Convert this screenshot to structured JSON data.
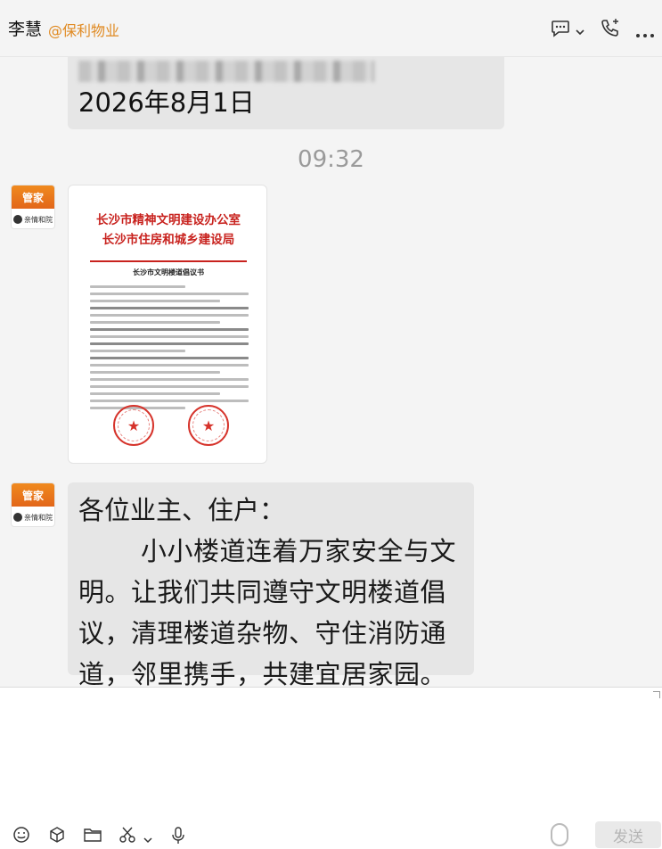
{
  "header": {
    "contact_name": "李慧",
    "contact_org": "@保利物业",
    "icons": [
      "chat-bubble-icon",
      "chevron-down-icon",
      "phone-icon",
      "more-icon"
    ]
  },
  "messages": {
    "top_bubble_date": "2026年8月1日",
    "timestamp": "09:32",
    "avatar": {
      "badge": "管家",
      "brand": "亲情和院"
    },
    "document_image": {
      "org_line_1": "长沙市精神文明建设办公室",
      "org_line_2": "长沙市住房和城乡建设局",
      "doc_title": "长沙市文明楼道倡议书"
    },
    "text_message": {
      "greeting": "各位业主、住户：",
      "body": "小小楼道连着万家安全与文明。让我们共同遵守文明楼道倡议，清理楼道杂物、守住消防通道，邻里携手，共建宜居家园。"
    }
  },
  "input": {
    "send_label": "发送",
    "toolbar_icons": [
      "emoji-icon",
      "box-icon",
      "folder-icon",
      "scissors-icon",
      "chevron-down-icon",
      "microphone-icon"
    ]
  },
  "colors": {
    "org_accent": "#e08a22",
    "doc_red": "#c8221e",
    "bubble_bg": "#e6e6e6",
    "timestamp_gray": "#9a9a9a"
  }
}
